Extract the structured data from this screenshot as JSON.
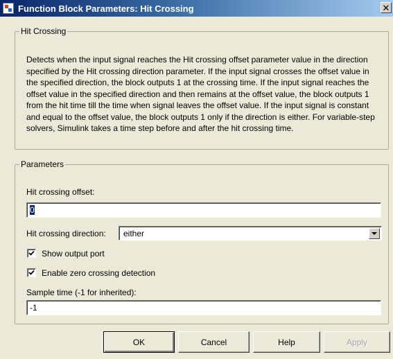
{
  "window": {
    "title": "Function Block Parameters: Hit  Crossing",
    "close_glyph": "✕"
  },
  "description": {
    "group_label": "Hit Crossing",
    "text": "Detects when the input signal reaches the Hit crossing offset parameter value in the direction specified by the Hit crossing direction parameter. If the input signal crosses the offset value in the specified direction, the block outputs 1 at the crossing time. If the input signal reaches the offset value in the specified direction and then remains at the offset value, the block outputs 1 from the hit time till the time when signal leaves the offset value. If the input signal is constant and equal to the offset value, the block outputs 1 only if the direction is either. For variable-step solvers, Simulink takes a time step before and after the hit crossing time."
  },
  "parameters": {
    "group_label": "Parameters",
    "offset": {
      "label": "Hit crossing offset:",
      "value": "0"
    },
    "direction": {
      "label": "Hit crossing direction:",
      "value": "either"
    },
    "show_output_port": {
      "label": "Show output port",
      "checked": true
    },
    "zero_crossing": {
      "label": "Enable zero crossing detection",
      "checked": true
    },
    "sample_time": {
      "label": "Sample time (-1 for inherited):",
      "value": "-1"
    }
  },
  "buttons": {
    "ok": "OK",
    "cancel": "Cancel",
    "help": "Help",
    "apply": "Apply"
  }
}
